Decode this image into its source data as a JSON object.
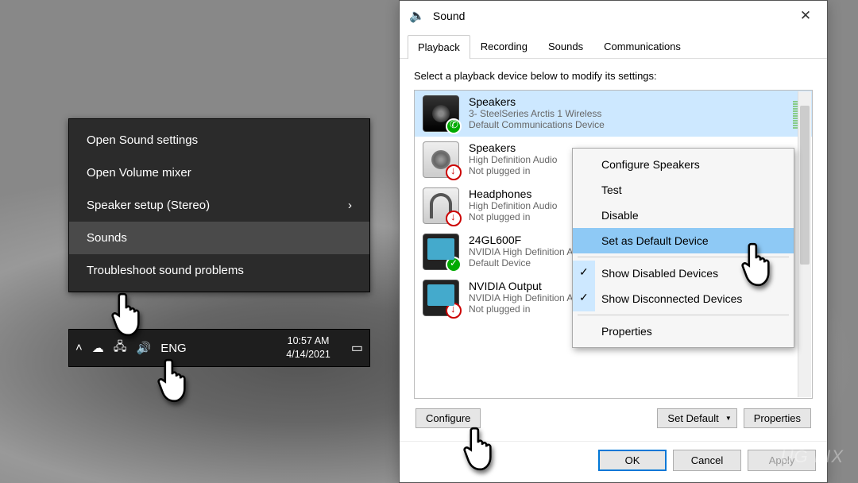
{
  "context_menu": {
    "items": [
      {
        "label": "Open Sound settings"
      },
      {
        "label": "Open Volume mixer"
      },
      {
        "label": "Speaker setup (Stereo)",
        "arrow": true
      },
      {
        "label": "Sounds",
        "hover": true
      },
      {
        "label": "Troubleshoot sound problems"
      }
    ]
  },
  "taskbar": {
    "lang": "ENG",
    "time": "10:57 AM",
    "date": "4/14/2021"
  },
  "dialog": {
    "title": "Sound",
    "tabs": [
      "Playback",
      "Recording",
      "Sounds",
      "Communications"
    ],
    "active_tab": "Playback",
    "instruction": "Select a playback device below to modify its settings:",
    "devices": [
      {
        "name": "Speakers",
        "line2": "3- SteelSeries Arctis 1 Wireless",
        "line3": "Default Communications Device",
        "icon": "speaker",
        "badge": "phone",
        "selected": true,
        "bars": true
      },
      {
        "name": "Speakers",
        "line2": "High Definition Audio",
        "line3": "Not plugged in",
        "icon": "spk2",
        "badge": "red"
      },
      {
        "name": "Headphones",
        "line2": "High Definition Audio",
        "line3": "Not plugged in",
        "icon": "hp",
        "badge": "red"
      },
      {
        "name": "24GL600F",
        "line2": "NVIDIA High Definition Audio",
        "line3": "Default Device",
        "icon": "mon",
        "badge": "green"
      },
      {
        "name": "NVIDIA Output",
        "line2": "NVIDIA High Definition Audio",
        "line3": "Not plugged in",
        "icon": "mon",
        "badge": "red"
      }
    ],
    "device_context": [
      {
        "label": "Configure Speakers"
      },
      {
        "label": "Test"
      },
      {
        "label": "Disable"
      },
      {
        "label": "Set as Default Device",
        "selected": true
      },
      {
        "sep": true
      },
      {
        "label": "Show Disabled Devices",
        "checked": true
      },
      {
        "label": "Show Disconnected Devices",
        "checked": true
      },
      {
        "sep": true
      },
      {
        "label": "Properties"
      }
    ],
    "buttons": {
      "configure": "Configure",
      "set_default": "Set Default",
      "properties": "Properties",
      "ok": "OK",
      "cancel": "Cancel",
      "apply": "Apply"
    }
  },
  "watermark": "UG   FIX"
}
